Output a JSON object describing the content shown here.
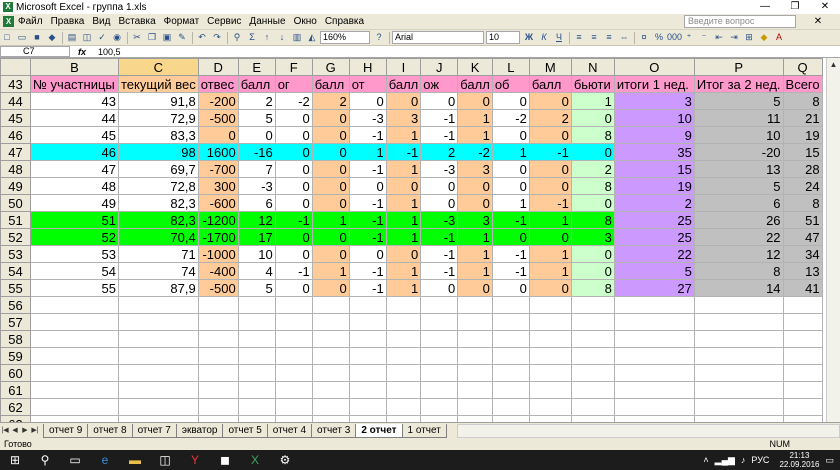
{
  "window": {
    "title": "Microsoft Excel - группа 1.xls",
    "min": "—",
    "max": "❐",
    "close": "✕"
  },
  "menu": {
    "items": [
      "Файл",
      "Правка",
      "Вид",
      "Вставка",
      "Формат",
      "Сервис",
      "Данные",
      "Окно",
      "Справка"
    ],
    "ask_placeholder": "Введите вопрос",
    "close": "✕"
  },
  "toolbar": {
    "zoom": "160%",
    "font": "Arial",
    "size": "10"
  },
  "formula": {
    "cell": "C7",
    "fx": "fx",
    "value": "100,5"
  },
  "colors": {
    "header_pink": "#ff99cc",
    "orange": "#ffcc99",
    "purple": "#cc99ff",
    "gray": "#c0c0c0",
    "cyan": "#00ffff",
    "green": "#00ff00",
    "teal": "#ccffcc"
  },
  "columns": [
    "",
    "B",
    "C",
    "D",
    "E",
    "F",
    "G",
    "H",
    "I",
    "J",
    "K",
    "L",
    "M",
    "N",
    "O",
    "P",
    "Q"
  ],
  "header_row": {
    "num": "43",
    "cells": [
      "№ участницы",
      "текущий вес",
      "отвес",
      "балл",
      "ог",
      "балл",
      "от",
      "балл",
      "ож",
      "балл",
      "об",
      "балл",
      "бьюти",
      "итоги 1 нед.",
      "Итог за 2 нед.",
      "Всего"
    ]
  },
  "rows": [
    {
      "num": "44",
      "fill": "",
      "cells": [
        "43",
        "91,8",
        "-200",
        "2",
        "-2",
        "2",
        "0",
        "0",
        "0",
        "0",
        "0",
        "0",
        "1",
        "3",
        "5",
        "8"
      ]
    },
    {
      "num": "45",
      "fill": "",
      "cells": [
        "44",
        "72,9",
        "-500",
        "5",
        "0",
        "0",
        "-3",
        "3",
        "-1",
        "1",
        "-2",
        "2",
        "0",
        "10",
        "11",
        "21"
      ]
    },
    {
      "num": "46",
      "fill": "",
      "cells": [
        "45",
        "83,3",
        "0",
        "0",
        "0",
        "0",
        "-1",
        "1",
        "-1",
        "1",
        "0",
        "0",
        "8",
        "9",
        "10",
        "19"
      ]
    },
    {
      "num": "47",
      "fill": "cyan",
      "cells": [
        "46",
        "98",
        "1600",
        "-16",
        "0",
        "0",
        "1",
        "-1",
        "2",
        "-2",
        "1",
        "-1",
        "0",
        "35",
        "-20",
        "15"
      ]
    },
    {
      "num": "48",
      "fill": "",
      "cells": [
        "47",
        "69,7",
        "-700",
        "7",
        "0",
        "0",
        "-1",
        "1",
        "-3",
        "3",
        "0",
        "0",
        "2",
        "15",
        "13",
        "28"
      ]
    },
    {
      "num": "49",
      "fill": "",
      "cells": [
        "48",
        "72,8",
        "300",
        "-3",
        "0",
        "0",
        "0",
        "0",
        "0",
        "0",
        "0",
        "0",
        "8",
        "19",
        "5",
        "24"
      ]
    },
    {
      "num": "50",
      "fill": "",
      "cells": [
        "49",
        "82,3",
        "-600",
        "6",
        "0",
        "0",
        "-1",
        "1",
        "0",
        "0",
        "1",
        "-1",
        "0",
        "2",
        "6",
        "8"
      ]
    },
    {
      "num": "51",
      "fill": "green",
      "cells": [
        "51",
        "82,3",
        "-1200",
        "12",
        "-1",
        "1",
        "-1",
        "1",
        "-3",
        "3",
        "-1",
        "1",
        "8",
        "25",
        "26",
        "51"
      ]
    },
    {
      "num": "52",
      "fill": "green",
      "cells": [
        "52",
        "70,4",
        "-1700",
        "17",
        "0",
        "0",
        "-1",
        "1",
        "-1",
        "1",
        "0",
        "0",
        "3",
        "25",
        "22",
        "47"
      ]
    },
    {
      "num": "53",
      "fill": "",
      "cells": [
        "53",
        "71",
        "-1000",
        "10",
        "0",
        "0",
        "0",
        "0",
        "-1",
        "1",
        "-1",
        "1",
        "0",
        "22",
        "12",
        "34"
      ]
    },
    {
      "num": "54",
      "fill": "",
      "cells": [
        "54",
        "74",
        "-400",
        "4",
        "-1",
        "1",
        "-1",
        "1",
        "-1",
        "1",
        "-1",
        "1",
        "0",
        "5",
        "8",
        "13"
      ]
    },
    {
      "num": "55",
      "fill": "",
      "cells": [
        "55",
        "87,9",
        "-500",
        "5",
        "0",
        "0",
        "-1",
        "1",
        "0",
        "0",
        "0",
        "0",
        "8",
        "27",
        "14",
        "41"
      ]
    }
  ],
  "empty_rows": [
    "56",
    "57",
    "58",
    "59",
    "60",
    "61",
    "62",
    "63"
  ],
  "tabs": [
    "отчет 9",
    "отчет 8",
    "отчет 7",
    "экватор",
    "отчет 5",
    "отчет 4",
    "отчет 3",
    "2 отчет",
    "1 отчет"
  ],
  "active_tab": "2 отчет",
  "status": {
    "ready": "Готово",
    "num": "NUM"
  },
  "taskbar": {
    "lang": "РУС",
    "time": "21:13",
    "date": "22.09.2016"
  }
}
